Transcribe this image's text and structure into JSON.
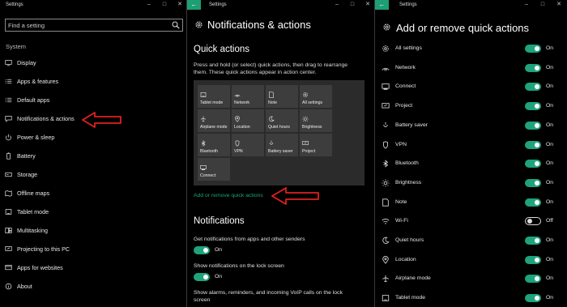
{
  "colors": {
    "accent": "#1ea37c",
    "arrow": "#e02020",
    "tile": "#3d3d3d",
    "grid_bg": "#2b2b2b"
  },
  "panel1": {
    "window_title": "Settings",
    "search_placeholder": "Find a setting",
    "section": "System",
    "items": [
      {
        "label": "Display",
        "icon": "display-icon"
      },
      {
        "label": "Apps & features",
        "icon": "list-icon"
      },
      {
        "label": "Default apps",
        "icon": "list-icon"
      },
      {
        "label": "Notifications & actions",
        "icon": "message-icon"
      },
      {
        "label": "Power & sleep",
        "icon": "power-icon"
      },
      {
        "label": "Battery",
        "icon": "battery-icon"
      },
      {
        "label": "Storage",
        "icon": "storage-icon"
      },
      {
        "label": "Offline maps",
        "icon": "map-icon"
      },
      {
        "label": "Tablet mode",
        "icon": "tablet-icon"
      },
      {
        "label": "Multitasking",
        "icon": "multitask-icon"
      },
      {
        "label": "Projecting to this PC",
        "icon": "project-icon"
      },
      {
        "label": "Apps for websites",
        "icon": "link-icon"
      },
      {
        "label": "About",
        "icon": "info-icon"
      }
    ]
  },
  "panel2": {
    "window_title": "Settings",
    "page_title": "Notifications & actions",
    "quick_actions_heading": "Quick actions",
    "quick_actions_desc": "Press and hold (or select) quick actions, then drag to rearrange them. These quick actions appear in action center.",
    "tiles": [
      [
        "Tablet mode",
        "Network",
        "Note",
        "All settings"
      ],
      [
        "Airplane mode",
        "Location",
        "Quiet hours",
        "Brightness"
      ],
      [
        "Bluetooth",
        "VPN",
        "Battery saver",
        "Project"
      ],
      [
        "Connect"
      ]
    ],
    "add_remove_link": "Add or remove quick actions",
    "notifications_heading": "Notifications",
    "settings": [
      {
        "label": "Get notifications from apps and other senders",
        "state": "On"
      },
      {
        "label": "Show notifications on the lock screen",
        "state": "On"
      }
    ],
    "trailing_text": "Show alarms, reminders, and incoming VoIP calls on the lock screen"
  },
  "panel3": {
    "window_title": "Settings",
    "page_title": "Add or remove quick actions",
    "items": [
      {
        "label": "All settings",
        "icon": "gear-icon",
        "state": "On"
      },
      {
        "label": "Network",
        "icon": "network-icon",
        "state": "On"
      },
      {
        "label": "Connect",
        "icon": "connect-icon",
        "state": "On"
      },
      {
        "label": "Project",
        "icon": "project-icon",
        "state": "On"
      },
      {
        "label": "Battery saver",
        "icon": "battery-saver-icon",
        "state": "On"
      },
      {
        "label": "VPN",
        "icon": "vpn-icon",
        "state": "On"
      },
      {
        "label": "Bluetooth",
        "icon": "bluetooth-icon",
        "state": "On"
      },
      {
        "label": "Brightness",
        "icon": "brightness-icon",
        "state": "On"
      },
      {
        "label": "Note",
        "icon": "note-icon",
        "state": "On"
      },
      {
        "label": "Wi-Fi",
        "icon": "wifi-icon",
        "state": "Off"
      },
      {
        "label": "Quiet hours",
        "icon": "moon-icon",
        "state": "On"
      },
      {
        "label": "Location",
        "icon": "location-icon",
        "state": "On"
      },
      {
        "label": "Airplane mode",
        "icon": "airplane-icon",
        "state": "On"
      },
      {
        "label": "Tablet mode",
        "icon": "tablet-icon",
        "state": "On"
      }
    ]
  }
}
